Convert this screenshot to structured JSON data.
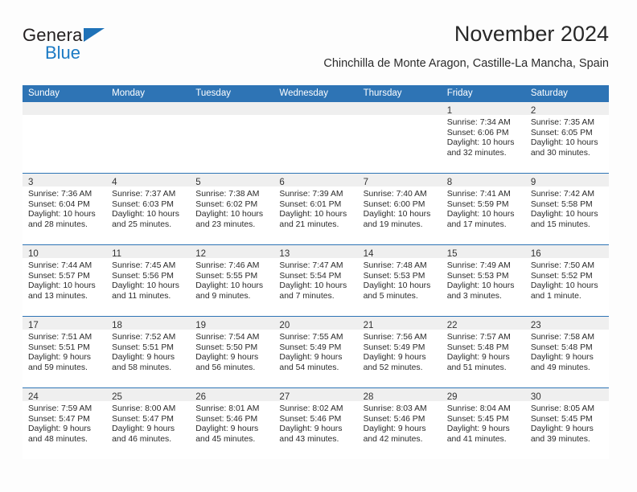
{
  "brand": {
    "name_top": "General",
    "name_bottom": "Blue",
    "accent_color": "#1b7ac4",
    "triangle_color": "#1f72b8"
  },
  "header": {
    "title": "November 2024",
    "subtitle": "Chinchilla de Monte Aragon, Castille-La Mancha, Spain"
  },
  "theme": {
    "header_bg": "#2e74b5",
    "header_text": "#ffffff",
    "daynum_band_bg": "#efefef",
    "cell_border": "#2e74b5",
    "page_bg": "#fdfdfd"
  },
  "calendar": {
    "weekday_headers": [
      "Sunday",
      "Monday",
      "Tuesday",
      "Wednesday",
      "Thursday",
      "Friday",
      "Saturday"
    ],
    "weeks": [
      [
        {
          "day": "",
          "sunrise": "",
          "sunset": "",
          "daylight": "",
          "empty": true
        },
        {
          "day": "",
          "sunrise": "",
          "sunset": "",
          "daylight": "",
          "empty": true
        },
        {
          "day": "",
          "sunrise": "",
          "sunset": "",
          "daylight": "",
          "empty": true
        },
        {
          "day": "",
          "sunrise": "",
          "sunset": "",
          "daylight": "",
          "empty": true
        },
        {
          "day": "",
          "sunrise": "",
          "sunset": "",
          "daylight": "",
          "empty": true
        },
        {
          "day": "1",
          "sunrise": "Sunrise: 7:34 AM",
          "sunset": "Sunset: 6:06 PM",
          "daylight": "Daylight: 10 hours and 32 minutes."
        },
        {
          "day": "2",
          "sunrise": "Sunrise: 7:35 AM",
          "sunset": "Sunset: 6:05 PM",
          "daylight": "Daylight: 10 hours and 30 minutes."
        }
      ],
      [
        {
          "day": "3",
          "sunrise": "Sunrise: 7:36 AM",
          "sunset": "Sunset: 6:04 PM",
          "daylight": "Daylight: 10 hours and 28 minutes."
        },
        {
          "day": "4",
          "sunrise": "Sunrise: 7:37 AM",
          "sunset": "Sunset: 6:03 PM",
          "daylight": "Daylight: 10 hours and 25 minutes."
        },
        {
          "day": "5",
          "sunrise": "Sunrise: 7:38 AM",
          "sunset": "Sunset: 6:02 PM",
          "daylight": "Daylight: 10 hours and 23 minutes."
        },
        {
          "day": "6",
          "sunrise": "Sunrise: 7:39 AM",
          "sunset": "Sunset: 6:01 PM",
          "daylight": "Daylight: 10 hours and 21 minutes."
        },
        {
          "day": "7",
          "sunrise": "Sunrise: 7:40 AM",
          "sunset": "Sunset: 6:00 PM",
          "daylight": "Daylight: 10 hours and 19 minutes."
        },
        {
          "day": "8",
          "sunrise": "Sunrise: 7:41 AM",
          "sunset": "Sunset: 5:59 PM",
          "daylight": "Daylight: 10 hours and 17 minutes."
        },
        {
          "day": "9",
          "sunrise": "Sunrise: 7:42 AM",
          "sunset": "Sunset: 5:58 PM",
          "daylight": "Daylight: 10 hours and 15 minutes."
        }
      ],
      [
        {
          "day": "10",
          "sunrise": "Sunrise: 7:44 AM",
          "sunset": "Sunset: 5:57 PM",
          "daylight": "Daylight: 10 hours and 13 minutes."
        },
        {
          "day": "11",
          "sunrise": "Sunrise: 7:45 AM",
          "sunset": "Sunset: 5:56 PM",
          "daylight": "Daylight: 10 hours and 11 minutes."
        },
        {
          "day": "12",
          "sunrise": "Sunrise: 7:46 AM",
          "sunset": "Sunset: 5:55 PM",
          "daylight": "Daylight: 10 hours and 9 minutes."
        },
        {
          "day": "13",
          "sunrise": "Sunrise: 7:47 AM",
          "sunset": "Sunset: 5:54 PM",
          "daylight": "Daylight: 10 hours and 7 minutes."
        },
        {
          "day": "14",
          "sunrise": "Sunrise: 7:48 AM",
          "sunset": "Sunset: 5:53 PM",
          "daylight": "Daylight: 10 hours and 5 minutes."
        },
        {
          "day": "15",
          "sunrise": "Sunrise: 7:49 AM",
          "sunset": "Sunset: 5:53 PM",
          "daylight": "Daylight: 10 hours and 3 minutes."
        },
        {
          "day": "16",
          "sunrise": "Sunrise: 7:50 AM",
          "sunset": "Sunset: 5:52 PM",
          "daylight": "Daylight: 10 hours and 1 minute."
        }
      ],
      [
        {
          "day": "17",
          "sunrise": "Sunrise: 7:51 AM",
          "sunset": "Sunset: 5:51 PM",
          "daylight": "Daylight: 9 hours and 59 minutes."
        },
        {
          "day": "18",
          "sunrise": "Sunrise: 7:52 AM",
          "sunset": "Sunset: 5:51 PM",
          "daylight": "Daylight: 9 hours and 58 minutes."
        },
        {
          "day": "19",
          "sunrise": "Sunrise: 7:54 AM",
          "sunset": "Sunset: 5:50 PM",
          "daylight": "Daylight: 9 hours and 56 minutes."
        },
        {
          "day": "20",
          "sunrise": "Sunrise: 7:55 AM",
          "sunset": "Sunset: 5:49 PM",
          "daylight": "Daylight: 9 hours and 54 minutes."
        },
        {
          "day": "21",
          "sunrise": "Sunrise: 7:56 AM",
          "sunset": "Sunset: 5:49 PM",
          "daylight": "Daylight: 9 hours and 52 minutes."
        },
        {
          "day": "22",
          "sunrise": "Sunrise: 7:57 AM",
          "sunset": "Sunset: 5:48 PM",
          "daylight": "Daylight: 9 hours and 51 minutes."
        },
        {
          "day": "23",
          "sunrise": "Sunrise: 7:58 AM",
          "sunset": "Sunset: 5:48 PM",
          "daylight": "Daylight: 9 hours and 49 minutes."
        }
      ],
      [
        {
          "day": "24",
          "sunrise": "Sunrise: 7:59 AM",
          "sunset": "Sunset: 5:47 PM",
          "daylight": "Daylight: 9 hours and 48 minutes."
        },
        {
          "day": "25",
          "sunrise": "Sunrise: 8:00 AM",
          "sunset": "Sunset: 5:47 PM",
          "daylight": "Daylight: 9 hours and 46 minutes."
        },
        {
          "day": "26",
          "sunrise": "Sunrise: 8:01 AM",
          "sunset": "Sunset: 5:46 PM",
          "daylight": "Daylight: 9 hours and 45 minutes."
        },
        {
          "day": "27",
          "sunrise": "Sunrise: 8:02 AM",
          "sunset": "Sunset: 5:46 PM",
          "daylight": "Daylight: 9 hours and 43 minutes."
        },
        {
          "day": "28",
          "sunrise": "Sunrise: 8:03 AM",
          "sunset": "Sunset: 5:46 PM",
          "daylight": "Daylight: 9 hours and 42 minutes."
        },
        {
          "day": "29",
          "sunrise": "Sunrise: 8:04 AM",
          "sunset": "Sunset: 5:45 PM",
          "daylight": "Daylight: 9 hours and 41 minutes."
        },
        {
          "day": "30",
          "sunrise": "Sunrise: 8:05 AM",
          "sunset": "Sunset: 5:45 PM",
          "daylight": "Daylight: 9 hours and 39 minutes."
        }
      ]
    ]
  }
}
